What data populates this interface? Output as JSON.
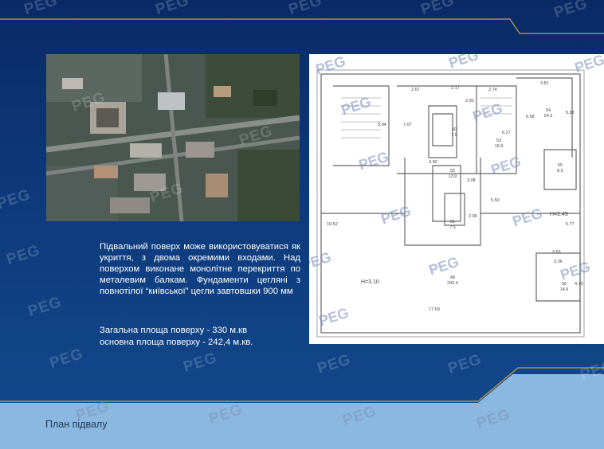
{
  "description": "Підвальний поверх може використовуватися як укриття, з двома окремими входами. Над поверхом виконане монолітне перекриття по металевим балкам. Фундаменти цегляні з повнотілої “київської” цегли завтовшки 900 мм",
  "areas": {
    "total": "Загальна площа поверху - 330 м.кв",
    "main": "основна площа поверху - 242,4 м.кв."
  },
  "caption": "План підвалу",
  "watermark": "PEG",
  "floor_plan": {
    "dimensions": [
      "2.67",
      "2.17",
      "2.74",
      "3.81",
      "2.90",
      "7.07",
      "5.94",
      "6.58",
      "5.93",
      "6.27",
      "3.90",
      "3.08",
      "5.50",
      "2.96",
      "3.55",
      "3.36",
      "4.70",
      "19.52",
      "17.69",
      "5.77"
    ],
    "heights": [
      "H=3.10",
      "H=2.49"
    ],
    "rooms": [
      {
        "num": "50",
        "area": "7.5"
      },
      {
        "num": "53",
        "area": "16.9"
      },
      {
        "num": "54",
        "area": "24.3"
      },
      {
        "num": "52",
        "area": "13.9"
      },
      {
        "num": "55",
        "area": "8.0"
      },
      {
        "num": "51",
        "area": "7.5"
      },
      {
        "num": "49",
        "area": "242.4"
      },
      {
        "num": "56",
        "area": "14.9"
      }
    ]
  },
  "colors": {
    "accent": "#c9a23a",
    "bg": "#0d3470",
    "band": "#8ab8e0"
  }
}
